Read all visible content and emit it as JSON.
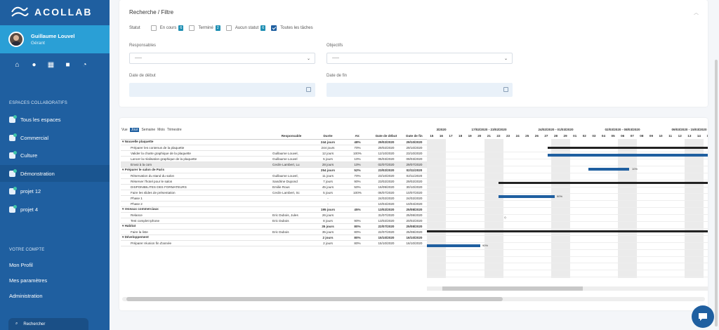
{
  "brand": {
    "name": "ACOLLAB"
  },
  "user": {
    "name": "Guillaume Louvel",
    "role": "Gérant"
  },
  "quick_icons": [
    "home-icon",
    "users-icon",
    "calendar-icon",
    "briefcase-icon",
    "clock-icon"
  ],
  "sidebar": {
    "spaces_title": "ESPACES COLLABORATIFS",
    "items": [
      {
        "label": "Tous les espaces"
      },
      {
        "label": "Commercial"
      },
      {
        "label": "Culture"
      },
      {
        "label": "Démonstration"
      },
      {
        "label": "projet 12"
      },
      {
        "label": "projet 4"
      }
    ],
    "account_title": "VOTRE COMPTE",
    "account": [
      {
        "label": "Mon Profil"
      },
      {
        "label": "Mes paramètres"
      },
      {
        "label": "Administration"
      }
    ],
    "search_placeholder": "Rechercher"
  },
  "filter": {
    "title": "Recherche / Filtre",
    "status_label": "Statut",
    "statuses": [
      {
        "label": "En cours",
        "count": "6",
        "checked": false
      },
      {
        "label": "Terminé",
        "count": "2",
        "checked": false
      },
      {
        "label": "Aucun statut",
        "count": "6",
        "checked": false
      },
      {
        "label": "Toutes les tâches",
        "count": "",
        "checked": true
      }
    ],
    "responsables_label": "Responsables",
    "responsables_value": "-----",
    "objectifs_label": "Objectifs",
    "objectifs_value": "-----",
    "date_debut_label": "Date de début",
    "date_fin_label": "Date de fin"
  },
  "gantt": {
    "views": [
      "Vue",
      "Jour",
      "Semaine",
      "Mois",
      "Trimestre"
    ],
    "active_view": "Jour",
    "columns": [
      "",
      "Responsable",
      "Durée",
      "AV.",
      "Date de début",
      "Date de fin"
    ],
    "rows": [
      {
        "name": "▾ Nouvelle plaquette",
        "resp": "",
        "dur": "244 jours",
        "av": "48%",
        "deb": "29/02/2020",
        "fin": "29/10/2020",
        "group": true
      },
      {
        "name": "Préparer les contenus de la plaquette",
        "resp": "",
        "dur": "244 jours",
        "av": "70%",
        "deb": "29/02/2020",
        "fin": "29/10/2020"
      },
      {
        "name": "Valider la charte graphique de la plaquette",
        "resp": "Guillaume Louvel,",
        "dur": "12 jours",
        "av": "100%",
        "deb": "12/10/2020",
        "fin": "23/10/2020"
      },
      {
        "name": "Lancer la réalisation graphique de la plaquette",
        "resp": "Guillaume Louvel",
        "dur": "5 jours",
        "av": "10%",
        "deb": "05/03/2020",
        "fin": "09/03/2020"
      },
      {
        "name": "Envoi à la com",
        "resp": "Cecile Lambert, Lu",
        "dur": "28 jours",
        "av": "10%",
        "deb": "02/07/2020",
        "fin": "29/07/2020",
        "hl": true
      },
      {
        "name": "▾ Préparer le salon de Paris",
        "resp": "",
        "dur": "254 jours",
        "av": "52%",
        "deb": "23/02/2020",
        "fin": "02/11/2020",
        "group": true
      },
      {
        "name": "Réservation du stand du salon",
        "resp": "Guillaume Louvel,",
        "dur": "11 jours",
        "av": "70%",
        "deb": "23/10/2020",
        "fin": "02/11/2020"
      },
      {
        "name": "Réserver l'hotel pour le salon",
        "resp": "Sandrine Dupond",
        "dur": "7 jours",
        "av": "90%",
        "deb": "23/02/2020",
        "fin": "29/02/2020"
      },
      {
        "name": "DISPONIBILITES DES FORMATEURS",
        "resp": "Emilie Rous",
        "dur": "45 jours",
        "av": "50%",
        "deb": "16/09/2020",
        "fin": "30/10/2020"
      },
      {
        "name": "Faire les slides de présentation",
        "resp": "Cecile Lambert, Sc",
        "dur": "5 jours",
        "av": "100%",
        "deb": "06/07/2020",
        "fin": "10/07/2020"
      },
      {
        "name": "Phase 1",
        "resp": "",
        "dur": "-",
        "av": "",
        "deb": "24/02/2020",
        "fin": "24/02/2020"
      },
      {
        "name": "Phase 2",
        "resp": "",
        "dur": "-",
        "av": "",
        "deb": "10/04/2020",
        "fin": "10/04/2020"
      },
      {
        "name": "▾ reseaux commerciaux",
        "resp": "",
        "dur": "195 jours",
        "av": "45%",
        "deb": "13/02/2020",
        "fin": "25/08/2020",
        "group": true
      },
      {
        "name": "Relance",
        "resp": "Eric Dubois, Jules",
        "dur": "26 jours",
        "av": "",
        "deb": "31/07/2020",
        "fin": "25/08/2020"
      },
      {
        "name": "Test complet Iphone",
        "resp": "Eric Dubois",
        "dur": "8 jours",
        "av": "90%",
        "deb": "13/02/2020",
        "fin": "20/02/2020"
      },
      {
        "name": "▾ Habitat",
        "resp": "",
        "dur": "35 jours",
        "av": "80%",
        "deb": "22/07/2020",
        "fin": "25/08/2020",
        "group": true
      },
      {
        "name": "Faire la liste",
        "resp": "Eric Dubois",
        "dur": "35 jours",
        "av": "80%",
        "deb": "22/07/2020",
        "fin": "25/08/2020"
      },
      {
        "name": "▾ Développement",
        "resp": "",
        "dur": "2 jours",
        "av": "80%",
        "deb": "15/10/2020",
        "fin": "16/10/2020",
        "group": true
      },
      {
        "name": "Préparer réunion fin d'année",
        "resp": "",
        "dur": "2 jours",
        "av": "80%",
        "deb": "15/10/2020",
        "fin": "16/10/2020"
      }
    ],
    "weeks": [
      "3/2020",
      "17/02/2020 - 23/02/2020",
      "24/02/2020 - 01/03/2020",
      "02/03/2020 - 08/03/2020",
      "09/03/2020 - 15/03/2020",
      "16/03/2"
    ],
    "days": [
      "15",
      "16",
      "17",
      "18",
      "19",
      "20",
      "21",
      "22",
      "23",
      "24",
      "25",
      "26",
      "27",
      "28",
      "29",
      "01",
      "02",
      "03",
      "04",
      "05",
      "06",
      "07",
      "08",
      "09",
      "10",
      "11",
      "12",
      "13",
      "14",
      "15",
      "16",
      "17",
      "18"
    ],
    "bar_labels": [
      "10%",
      "90%",
      "90%"
    ]
  }
}
